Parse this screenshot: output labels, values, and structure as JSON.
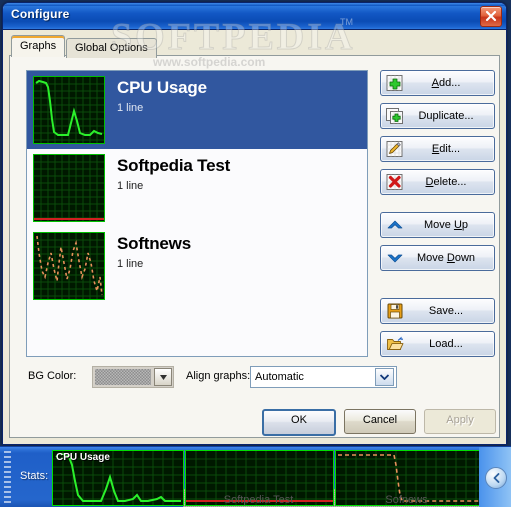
{
  "window": {
    "title": "Configure",
    "close_icon": "close-icon"
  },
  "tabs": [
    {
      "label": "Graphs",
      "active": true
    },
    {
      "label": "Global Options",
      "active": false
    }
  ],
  "graph_list": [
    {
      "name": "CPU Usage",
      "lines": "1 line",
      "selected": true,
      "line_color": "#2bf02b",
      "style": "solid"
    },
    {
      "name": "Softpedia Test",
      "lines": "1 line",
      "selected": false,
      "line_color": "#d02020",
      "style": "flat"
    },
    {
      "name": "Softnews",
      "lines": "1 line",
      "selected": false,
      "line_color": "#e8915a",
      "style": "dashed"
    }
  ],
  "side_buttons": [
    {
      "label": "Add...",
      "accel": "A",
      "icon": "add-icon"
    },
    {
      "label": "Duplicate...",
      "accel": "",
      "icon": "duplicate-icon"
    },
    {
      "label": "Edit...",
      "accel": "E",
      "icon": "edit-pencil-icon"
    },
    {
      "label": "Delete...",
      "accel": "D",
      "icon": "delete-icon"
    },
    {
      "label": "Move Up",
      "accel": "U",
      "icon": "chevron-up-icon"
    },
    {
      "label": "Move Down",
      "accel": "D",
      "icon": "chevron-down-icon"
    },
    {
      "label": "Save...",
      "accel": "",
      "icon": "floppy-disk-icon"
    },
    {
      "label": "Load...",
      "accel": "",
      "icon": "folder-open-icon"
    }
  ],
  "bg_color": {
    "label": "BG Color:",
    "value": "",
    "enabled": false
  },
  "align_graphs": {
    "label": "Align graphs:",
    "value": "Automatic",
    "options": [
      "Automatic"
    ]
  },
  "dialog_buttons": {
    "ok": "OK",
    "cancel": "Cancel",
    "apply": "Apply"
  },
  "taskbar": {
    "stats_label": "Stats:",
    "tray_icon": "chevron-left-icon",
    "graphs": [
      {
        "title": "CPU Usage",
        "caption": ""
      },
      {
        "title": "",
        "caption": "Softpedia Test"
      },
      {
        "title": "",
        "caption": "Sofnews"
      }
    ]
  },
  "watermark": {
    "main": "SOFTPEDIA",
    "sub": "www.softpedia.com",
    "tm": "TM"
  },
  "colors": {
    "selection_blue": "#31579f",
    "titlebar_blue": "#1257c4",
    "accent_orange": "#f0a830",
    "graph_green": "#00e000",
    "graph_bg": "#001800"
  }
}
